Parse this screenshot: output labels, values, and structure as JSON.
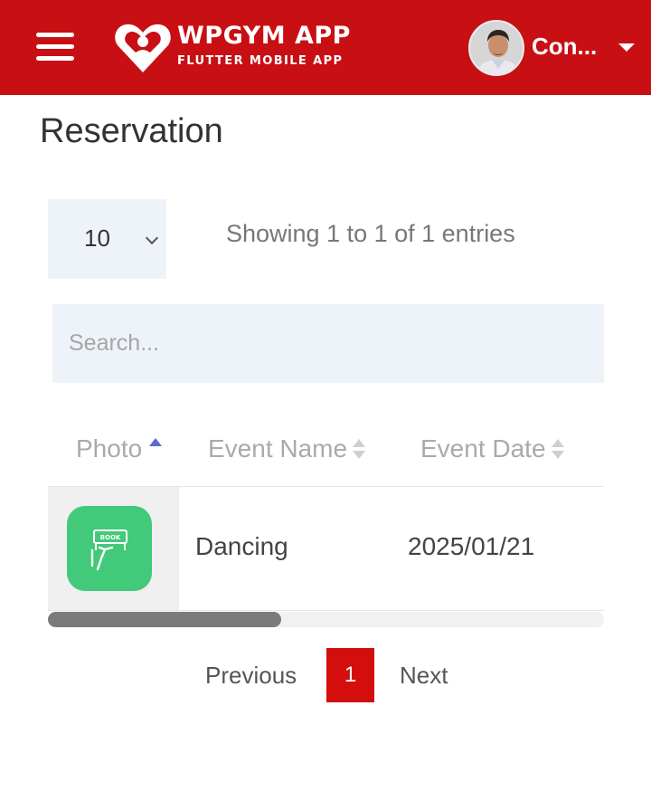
{
  "header": {
    "brand_title": "WPGYM APP",
    "brand_subtitle": "FLUTTER MOBILE APP",
    "user_name": "Con...",
    "color": "#c80f14"
  },
  "page": {
    "title": "Reservation"
  },
  "table_controls": {
    "page_length": "10",
    "info": "Showing 1 to 1 of 1 entries",
    "search_placeholder": "Search..."
  },
  "table": {
    "columns": [
      "Photo",
      "Event Name",
      "Event Date"
    ],
    "sorted_column": "Photo",
    "rows": [
      {
        "photo_icon": "book-sign-icon",
        "event_name": "Dancing",
        "event_date": "2025/01/21"
      }
    ],
    "horizontal_scroll_fraction": 0.42
  },
  "pagination": {
    "previous_label": "Previous",
    "current_page": "1",
    "next_label": "Next",
    "active_color": "#d40d0d"
  }
}
